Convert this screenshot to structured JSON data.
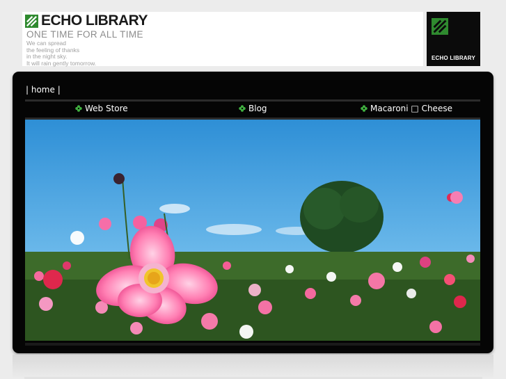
{
  "header": {
    "logo_text": "ECHO LIBRARY",
    "tagline": "ONE TIME FOR ALL TIME",
    "poem": [
      "We can spread",
      "the feeling of thanks",
      "in the night sky.",
      "It will rain gently tomorrow."
    ],
    "badge_text": "ECHO LIBRARY",
    "brand_green": "#2f8a2f"
  },
  "topnav": {
    "prefix": "| ",
    "home": "home",
    "suffix": " |"
  },
  "nav": {
    "items": [
      {
        "label": "Web Store"
      },
      {
        "label": "Blog"
      },
      {
        "label": "Macaroni □ Cheese"
      }
    ],
    "icon": "clover-icon"
  },
  "hero": {
    "description_icon": "flower-field-photo"
  }
}
